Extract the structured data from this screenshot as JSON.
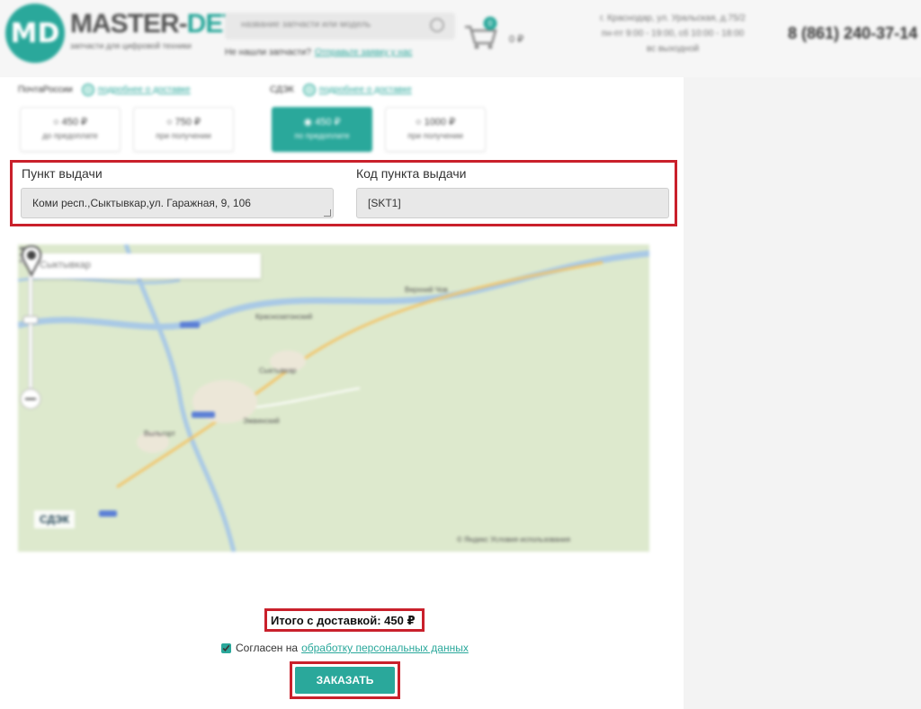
{
  "header": {
    "logo_mark": "MD",
    "logo_name_a": "MASTER-",
    "logo_name_b": "DETAL",
    "logo_tagline": "запчасти для цифровой техники",
    "search_placeholder": "название запчасти или модель",
    "notfound_text": "Не нашли запчасти?",
    "notfound_link": "Отправьте заявку у нас",
    "cart_count": "0",
    "cart_sum": "0 ₽",
    "address_line1": "г. Краснодар, ул. Уральская, д.75/2",
    "address_line2": "пн-пт 9:00 - 19:00, сб 10:00 - 18:00",
    "address_line3": "вс выходной",
    "phone": "8 (861) 240-37-14"
  },
  "delivery": {
    "carriers": [
      {
        "name": "ПочтаРоссии",
        "info_link": "подробнее о доставке"
      },
      {
        "name": "СДЭК",
        "info_link": "подробнее о доставке"
      }
    ],
    "options": [
      {
        "price": "○ 450 ₽",
        "sub": "до предоплате",
        "active": false
      },
      {
        "price": "○ 750 ₽",
        "sub": "при получении",
        "active": false
      },
      {
        "price": "◉ 450 ₽",
        "sub": "по предоплате",
        "active": true
      },
      {
        "price": "○ 1000 ₽",
        "sub": "при получении",
        "active": false
      }
    ]
  },
  "pickup": {
    "point_label": "Пункт выдачи",
    "point_value": "Коми респ.,Сыктывкар,ул. Гаражная, 9, 106",
    "code_label": "Код пункта выдачи",
    "code_value": "[SKT1]"
  },
  "map": {
    "search_value": "Сыктывкар",
    "logo": "СДЭК",
    "copyright": "© Яндекс  Условия использования",
    "labels": [
      "Краснозатонский",
      "Сыктывкар",
      "Эжвинский",
      "Верхний Чов",
      "Выльгорт"
    ]
  },
  "summary": {
    "total": "Итого с доставкой: 450 ₽",
    "agree_prefix": "Согласен на",
    "agree_link": "обработку персональных данных",
    "agree_checked": true,
    "order_button": "ЗАКАЗАТЬ"
  },
  "colors": {
    "accent": "#2aa89b",
    "highlight": "#c9202b"
  }
}
